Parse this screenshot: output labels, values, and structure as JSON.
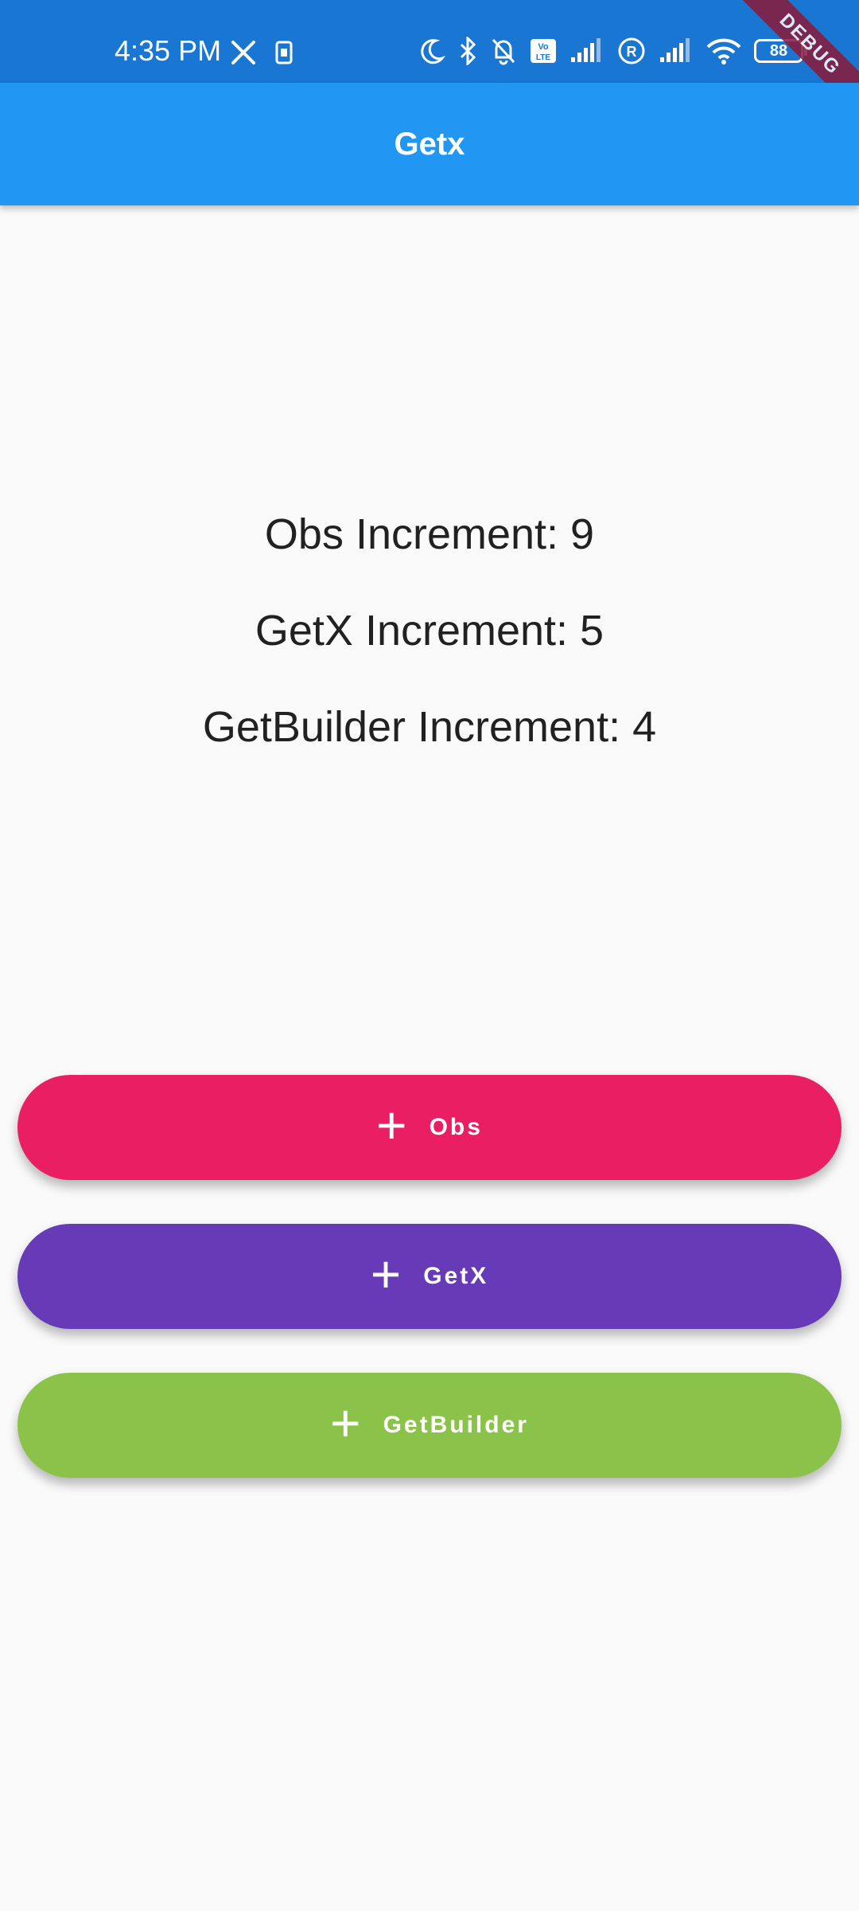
{
  "status_bar": {
    "time": "4:35 PM",
    "battery": "88",
    "icons": [
      "x-icon",
      "sim-card-icon",
      "moon-icon",
      "bluetooth-icon",
      "bell-off-icon",
      "volte-icon",
      "signal-icon",
      "registered-icon",
      "signal-icon",
      "wifi-icon",
      "battery-icon"
    ],
    "background_color": "#1976d2"
  },
  "debug_banner": "DEBUG",
  "app_bar": {
    "title": "Getx",
    "color": "#2196f3"
  },
  "counters": {
    "obs": "Obs Increment: 9",
    "getx": "GetX Increment: 5",
    "getbuilder": "GetBuilder Increment: 4"
  },
  "buttons": {
    "obs": {
      "label": "Obs",
      "icon": "plus-icon",
      "color": "#e91e63"
    },
    "getx": {
      "label": "GetX",
      "icon": "plus-icon",
      "color": "#673ab7"
    },
    "getbuilder": {
      "label": "GetBuilder",
      "icon": "plus-icon",
      "color": "#8bc34a"
    }
  }
}
